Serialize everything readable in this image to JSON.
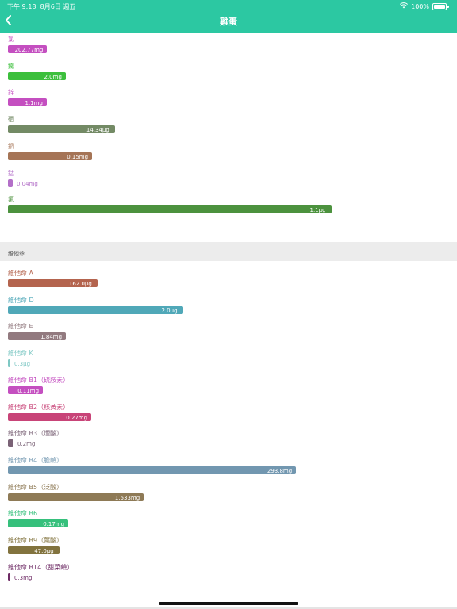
{
  "status": {
    "time": "下午 9:18",
    "date": "8月6日 週五",
    "battery": "100%"
  },
  "nav": {
    "title": "雞蛋",
    "back_icon": "chevron-left-icon"
  },
  "minerals": [
    {
      "name": "氯",
      "value": "202.77mg",
      "color": "#c44fc0",
      "fraction": 0.12
    },
    {
      "name": "鐵",
      "value": "2.0mg",
      "color": "#3cbf3c",
      "fraction": 0.18
    },
    {
      "name": "鋅",
      "value": "1.1mg",
      "color": "#c44fc0",
      "fraction": 0.12
    },
    {
      "name": "硒",
      "value": "14.34μg",
      "color": "#738a65",
      "fraction": 0.33
    },
    {
      "name": "銅",
      "value": "0.15mg",
      "color": "#a57456",
      "fraction": 0.26
    },
    {
      "name": "錳",
      "value": "0.04mg",
      "color": "#b36fc8",
      "fraction": 0.015
    },
    {
      "name": "氟",
      "value": "1.1μg",
      "color": "#4c923e",
      "fraction": 1.0
    }
  ],
  "vitamins_section": {
    "title": "維他命"
  },
  "vitamins": [
    {
      "name": "維他命 A",
      "value": "162.0μg",
      "color": "#b4644e",
      "fraction": 0.31
    },
    {
      "name": "維他命 D",
      "value": "2.0μg",
      "color": "#50a8b8",
      "fraction": 0.61
    },
    {
      "name": "維他命 E",
      "value": "1.84mg",
      "color": "#927a7f",
      "fraction": 0.2
    },
    {
      "name": "維他命 K",
      "value": "0.3μg",
      "color": "#7ec8c4",
      "fraction": 0.003
    },
    {
      "name": "維他命 B1（硫胺素）",
      "value": "0.11mg",
      "color": "#c44fc0",
      "fraction": 0.12
    },
    {
      "name": "維他命 B2（核黃素）",
      "value": "0.27mg",
      "color": "#c84478",
      "fraction": 0.29
    },
    {
      "name": "維他命 B3（煙酸）",
      "value": "0.2mg",
      "color": "#7a6276",
      "fraction": 0.02
    },
    {
      "name": "維他命 B4（膽鹼）",
      "value": "293.8mg",
      "color": "#7297b0",
      "fraction": 1.0
    },
    {
      "name": "維他命 B5（泛酸）",
      "value": "1.533mg",
      "color": "#8e7a56",
      "fraction": 0.47
    },
    {
      "name": "維他命 B6",
      "value": "0.17mg",
      "color": "#36c07c",
      "fraction": 0.21
    },
    {
      "name": "維他命 B9（葉酸）",
      "value": "47.0μg",
      "color": "#82733e",
      "fraction": 0.18
    },
    {
      "name": "維他命 B14（甜菜鹼）",
      "value": "0.3mg",
      "color": "#6d2a64",
      "fraction": 0.004
    }
  ]
}
